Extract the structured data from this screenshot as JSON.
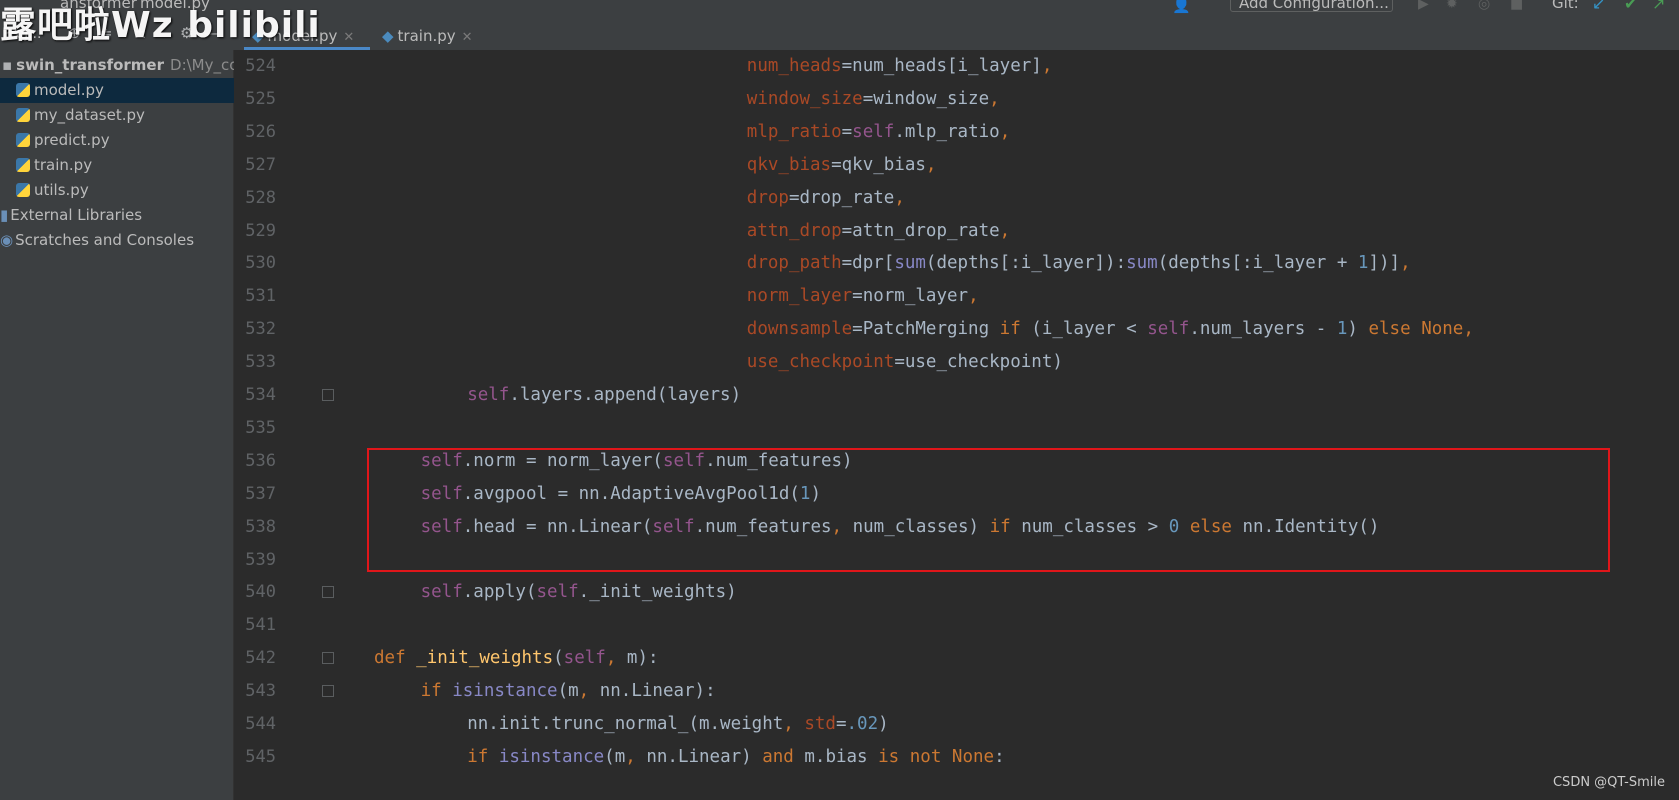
{
  "watermark": "露吧啦Wz bilibili",
  "topbar": {
    "crumb_1": "ansformer",
    "crumb_2": "model.py",
    "project_label": "Proj...",
    "config_button": "Add Configuration...",
    "git_label": "Git:",
    "tabs": [
      {
        "label": "model.py",
        "active": true
      },
      {
        "label": "train.py",
        "active": false
      }
    ]
  },
  "sidebar": {
    "root": {
      "name": "swin_transformer",
      "path": "D:\\My_code"
    },
    "files": [
      "model.py",
      "my_dataset.py",
      "predict.py",
      "train.py",
      "utils.py"
    ],
    "extras": [
      "External Libraries",
      "Scratches and Consoles"
    ],
    "selected": "model.py"
  },
  "editor": {
    "lines": [
      {
        "n": "524",
        "code": "num_heads=num_heads[i_layer],",
        "indent": 16
      },
      {
        "n": "525",
        "code": "window_size=window_size,",
        "indent": 16
      },
      {
        "n": "526",
        "code": "mlp_ratio=self.mlp_ratio,",
        "indent": 16
      },
      {
        "n": "527",
        "code": "qkv_bias=qkv_bias,",
        "indent": 16
      },
      {
        "n": "528",
        "code": "drop=drop_rate,",
        "indent": 16
      },
      {
        "n": "529",
        "code": "attn_drop=attn_drop_rate,",
        "indent": 16
      },
      {
        "n": "530",
        "code": "drop_path=dpr[sum(depths[:i_layer]):sum(depths[:i_layer + 1])],",
        "indent": 16
      },
      {
        "n": "531",
        "code": "norm_layer=norm_layer,",
        "indent": 16
      },
      {
        "n": "532",
        "code": "downsample=PatchMerging if (i_layer < self.num_layers - 1) else None,",
        "indent": 16
      },
      {
        "n": "533",
        "code": "use_checkpoint=use_checkpoint)",
        "indent": 16
      },
      {
        "n": "534",
        "code": "self.layers.append(layers)",
        "indent": 4
      },
      {
        "n": "535",
        "code": "",
        "indent": 0
      },
      {
        "n": "536",
        "code": "self.norm = norm_layer(self.num_features)",
        "indent": 2
      },
      {
        "n": "537",
        "code": "self.avgpool = nn.AdaptiveAvgPool1d(1)",
        "indent": 2
      },
      {
        "n": "538",
        "code": "self.head = nn.Linear(self.num_features, num_classes) if num_classes > 0 else nn.Identity()",
        "indent": 2
      },
      {
        "n": "539",
        "code": "",
        "indent": 0
      },
      {
        "n": "540",
        "code": "self.apply(self._init_weights)",
        "indent": 2
      },
      {
        "n": "541",
        "code": "",
        "indent": 0
      },
      {
        "n": "542",
        "code": "def _init_weights(self, m):",
        "indent": 0
      },
      {
        "n": "543",
        "code": "if isinstance(m, nn.Linear):",
        "indent": 2
      },
      {
        "n": "544",
        "code": "nn.init.trunc_normal_(m.weight, std=.02)",
        "indent": 4
      },
      {
        "n": "545",
        "code": "if isinstance(m, nn.Linear) and m.bias is not None:",
        "indent": 4
      }
    ]
  },
  "colors": {
    "keyword": "#cc7832",
    "self": "#94558d",
    "number": "#6897bb",
    "kwarg": "#aa4926",
    "builtin": "#8888c6",
    "highlight_border": "#e0161a"
  },
  "footer_credit": "CSDN @QT-Smile"
}
